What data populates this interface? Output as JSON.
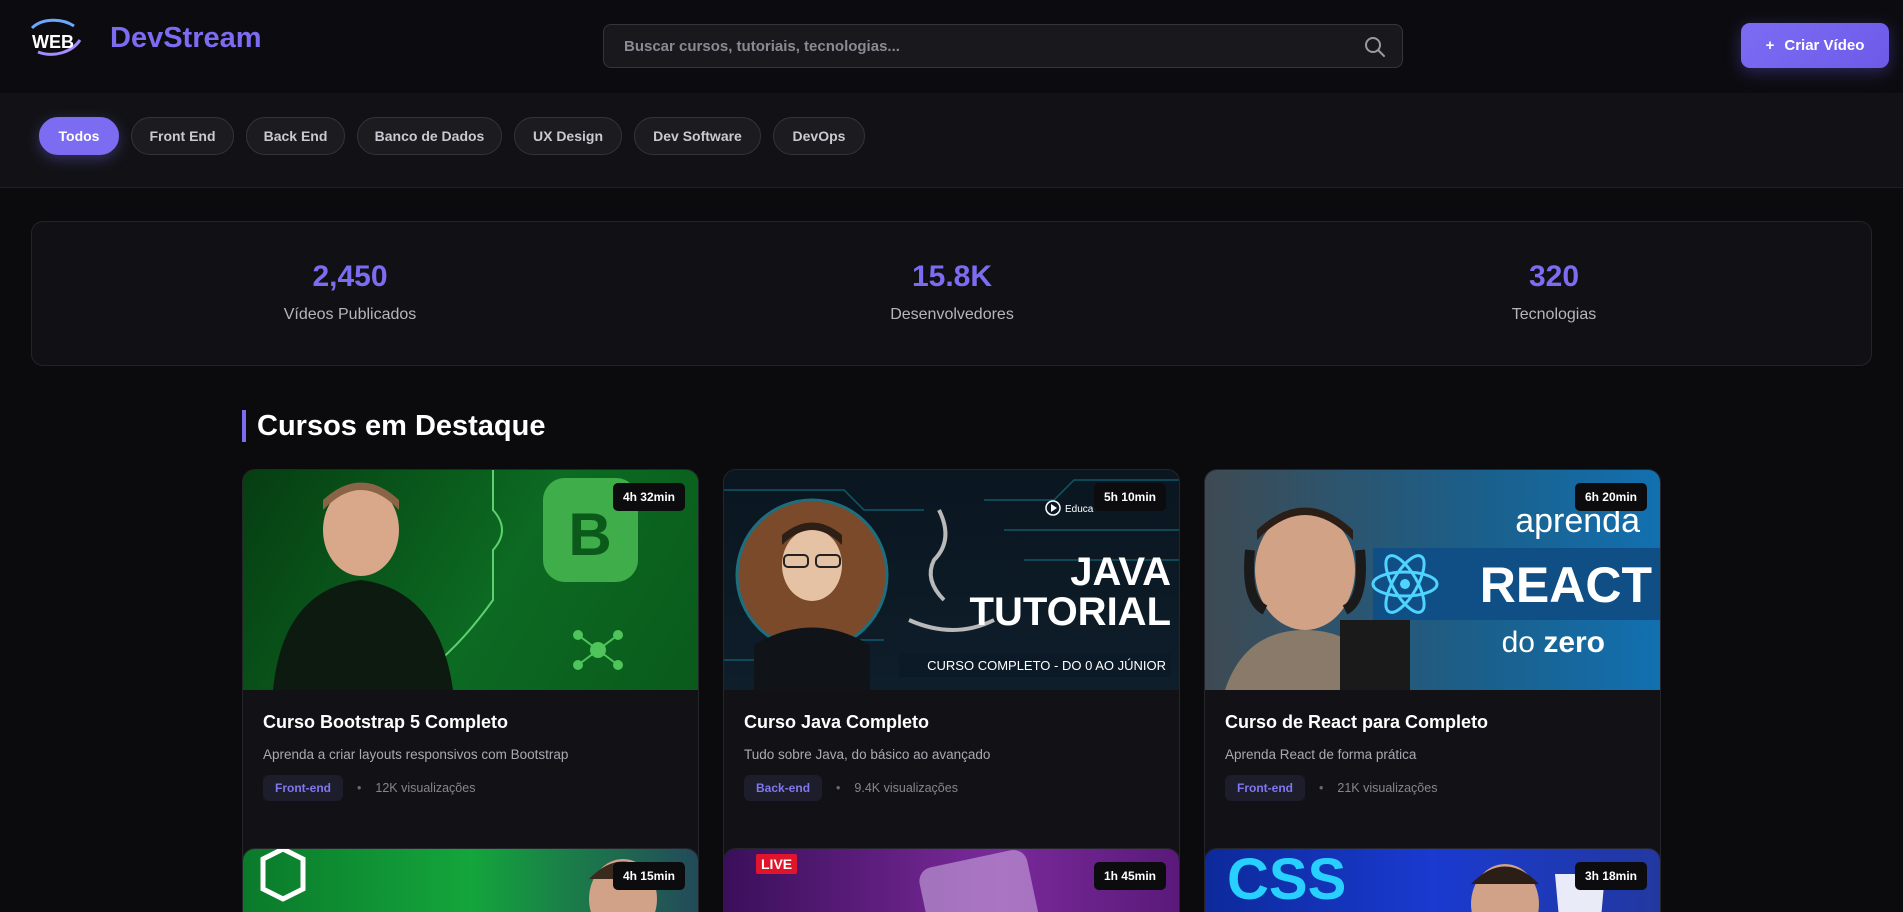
{
  "app": {
    "brand": "DevStream",
    "logo_text": "WEB"
  },
  "search": {
    "placeholder": "Buscar cursos, tutoriais, tecnologias..."
  },
  "create_button": {
    "icon": "+",
    "label": "Criar Vídeo"
  },
  "filters": [
    {
      "label": "Todos",
      "active": true
    },
    {
      "label": "Front End"
    },
    {
      "label": "Back End"
    },
    {
      "label": "Banco de Dados"
    },
    {
      "label": "UX Design"
    },
    {
      "label": "Dev Software"
    },
    {
      "label": "DevOps"
    }
  ],
  "stats": [
    {
      "value": "2,450",
      "label": "Vídeos Publicados"
    },
    {
      "value": "15.8K",
      "label": "Desenvolvedores"
    },
    {
      "value": "320",
      "label": "Tecnologias"
    }
  ],
  "section": {
    "title": "Cursos em Destaque"
  },
  "courses": [
    {
      "title": "Curso Bootstrap 5 Completo",
      "description": "Aprenda a criar layouts responsivos com Bootstrap",
      "tag": "Front-end",
      "views": "12K visualizações",
      "duration": "4h 32min",
      "thumb_letter": "B"
    },
    {
      "title": "Curso Java Completo",
      "description": "Tudo sobre Java, do básico ao avançado",
      "tag": "Back-end",
      "views": "9.4K visualizações",
      "duration": "5h 10min",
      "thumb_line1": "JAVA",
      "thumb_line2": "TUTORIAL",
      "thumb_caption": "CURSO COMPLETO - DO 0 AO JÚNIOR",
      "thumb_badge": "Educa"
    },
    {
      "title": "Curso de React para Completo",
      "description": "Aprenda React de forma prática",
      "tag": "Front-end",
      "views": "21K visualizações",
      "duration": "6h 20min",
      "thumb_top": "aprenda",
      "thumb_main": "REACT",
      "thumb_pre": "do",
      "thumb_bottom": "zero"
    },
    {
      "duration": "4h 15min"
    },
    {
      "duration": "1h 45min",
      "live": "LIVE"
    },
    {
      "duration": "3h 18min",
      "thumb_text": "CSS"
    }
  ],
  "colors": {
    "accent": "#7c6cf2",
    "background": "#0b0b0e",
    "card": "#121216"
  }
}
